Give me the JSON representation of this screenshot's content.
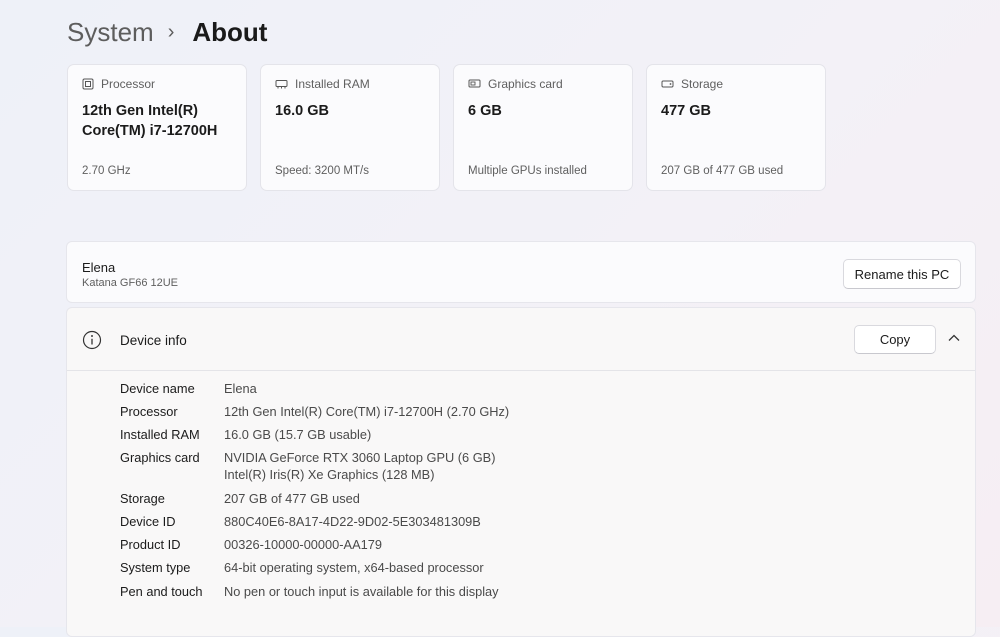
{
  "breadcrumb": {
    "parent": "System",
    "separator": "›",
    "current": "About"
  },
  "cards": [
    {
      "label": "Processor",
      "icon": "processor-icon",
      "value": "12th Gen Intel(R) Core(TM) i7-12700H",
      "sub": "2.70 GHz"
    },
    {
      "label": "Installed RAM",
      "icon": "ram-icon",
      "value": "16.0 GB",
      "sub": "Speed: 3200 MT/s"
    },
    {
      "label": "Graphics card",
      "icon": "graphics-card-icon",
      "value": "6 GB",
      "sub": "Multiple GPUs installed"
    },
    {
      "label": "Storage",
      "icon": "storage-icon",
      "value": "477 GB",
      "sub": "207 GB of 477 GB used"
    }
  ],
  "pc": {
    "name": "Elena",
    "model": "Katana GF66 12UE",
    "rename_label": "Rename this PC"
  },
  "device_info": {
    "title": "Device info",
    "copy_label": "Copy",
    "rows": [
      {
        "label": "Device name",
        "value": "Elena"
      },
      {
        "label": "Processor",
        "value": "12th Gen Intel(R) Core(TM) i7-12700H (2.70 GHz)"
      },
      {
        "label": "Installed RAM",
        "value": "16.0 GB (15.7 GB usable)"
      },
      {
        "label": "Graphics card",
        "value": "NVIDIA GeForce RTX 3060 Laptop GPU (6 GB)",
        "value2": "Intel(R) Iris(R) Xe Graphics (128 MB)"
      },
      {
        "label": "Storage",
        "value": "207 GB of 477 GB used"
      },
      {
        "label": "Device ID",
        "value": "880C40E6-8A17-4D22-9D02-5E303481309B"
      },
      {
        "label": "Product ID",
        "value": "00326-10000-00000-AA179"
      },
      {
        "label": "System type",
        "value": "64-bit operating system, x64-based processor"
      },
      {
        "label": "Pen and touch",
        "value": "No pen or touch input is available for this display"
      }
    ]
  }
}
